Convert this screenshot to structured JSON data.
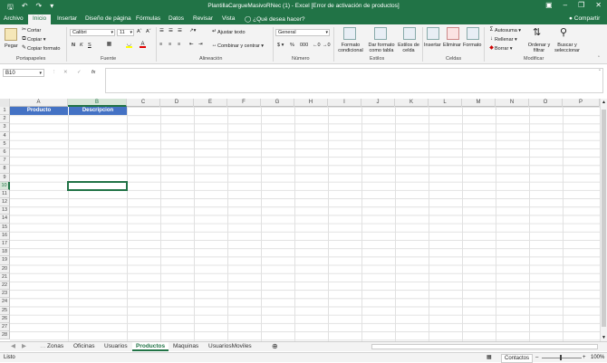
{
  "title_bar": {
    "title": "PlantillaCargueMasivoRNec (1) - Excel [Error de activación de productos]"
  },
  "tabs": [
    "Archivo",
    "Inicio",
    "Insertar",
    "Diseño de página",
    "Fórmulas",
    "Datos",
    "Revisar",
    "Vista"
  ],
  "tell_me": "¿Qué desea hacer?",
  "share": "Compartir",
  "ribbon": {
    "paste": "Pegar",
    "cut": "Cortar",
    "copy": "Copiar",
    "format_painter": "Copiar formato",
    "clipboard_label": "Portapapeles",
    "font_name": "Calibri",
    "font_size": "11",
    "font_label": "Fuente",
    "wrap_text": "Ajustar texto",
    "merge_center": "Combinar y centrar",
    "alignment_label": "Alineación",
    "number_format": "General",
    "number_label": "Número",
    "cond_format": "Formato condicional",
    "format_table": "Dar formato como tabla",
    "cell_styles": "Estilos de celda",
    "styles_label": "Estilos",
    "insert": "Insertar",
    "delete": "Eliminar",
    "format": "Formato",
    "cells_label": "Celdas",
    "autosum": "Autosuma",
    "fill": "Rellenar",
    "clear": "Borrar",
    "sort_filter": "Ordenar y filtrar",
    "find_select": "Buscar y seleccionar",
    "editing_label": "Modificar"
  },
  "name_box": "B10",
  "fx": "fx",
  "columns": [
    "A",
    "B",
    "C",
    "D",
    "E",
    "F",
    "G",
    "H",
    "I",
    "J",
    "K",
    "L",
    "M",
    "N",
    "O",
    "P"
  ],
  "rows": [
    "1",
    "2",
    "3",
    "4",
    "5",
    "6",
    "7",
    "8",
    "9",
    "10",
    "11",
    "12",
    "13",
    "14",
    "15",
    "16",
    "17",
    "18",
    "19",
    "20",
    "21",
    "22",
    "23",
    "24",
    "25",
    "26",
    "27",
    "28"
  ],
  "cells": {
    "A1": "Producto",
    "B1": "Descripcion"
  },
  "sheets": [
    "Zonas",
    "Oficinas",
    "Usuarios",
    "Productos",
    "Maquinas",
    "UsuariosMoviles"
  ],
  "active_sheet": "Productos",
  "status": {
    "ready": "Listo",
    "contacts": "Contactos",
    "zoom": "100%"
  },
  "colors": {
    "excel_green": "#217346",
    "header_fill": "#4472c4"
  }
}
